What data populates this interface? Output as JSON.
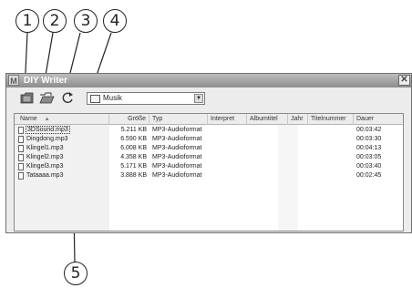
{
  "callouts": [
    "1",
    "2",
    "3",
    "4",
    "5"
  ],
  "window": {
    "app_icon": "M",
    "title": "DIY Writer",
    "close_glyph": "✕"
  },
  "toolbar": {
    "folder_select_value": "Musik",
    "dropdown_glyph": "▼"
  },
  "columns": [
    "Name",
    "Größe",
    "Typ",
    "Interpret",
    "Albumtitel",
    "Jahr",
    "Titelnummer",
    "Dauer"
  ],
  "sort_glyph": "▲",
  "files": [
    {
      "name": "3DSound.mp3",
      "size": "5.211 KB",
      "type": "MP3-Audioformat",
      "duration": "00:03:42"
    },
    {
      "name": "Dingdong.mp3",
      "size": "6.590 KB",
      "type": "MP3-Audioformat",
      "duration": "00:03:30"
    },
    {
      "name": "Klingel1.mp3",
      "size": "6.008 KB",
      "type": "MP3-Audioformat",
      "duration": "00:04:13"
    },
    {
      "name": "Klingel2.mp3",
      "size": "4.358 KB",
      "type": "MP3-Audioformat",
      "duration": "00:03:05"
    },
    {
      "name": "Klingel3.mp3",
      "size": "5.171 KB",
      "type": "MP3-Audioformat",
      "duration": "00:03:40"
    },
    {
      "name": "Tataaaa.mp3",
      "size": "3.888 KB",
      "type": "MP3-Audioformat",
      "duration": "00:02:45"
    }
  ]
}
